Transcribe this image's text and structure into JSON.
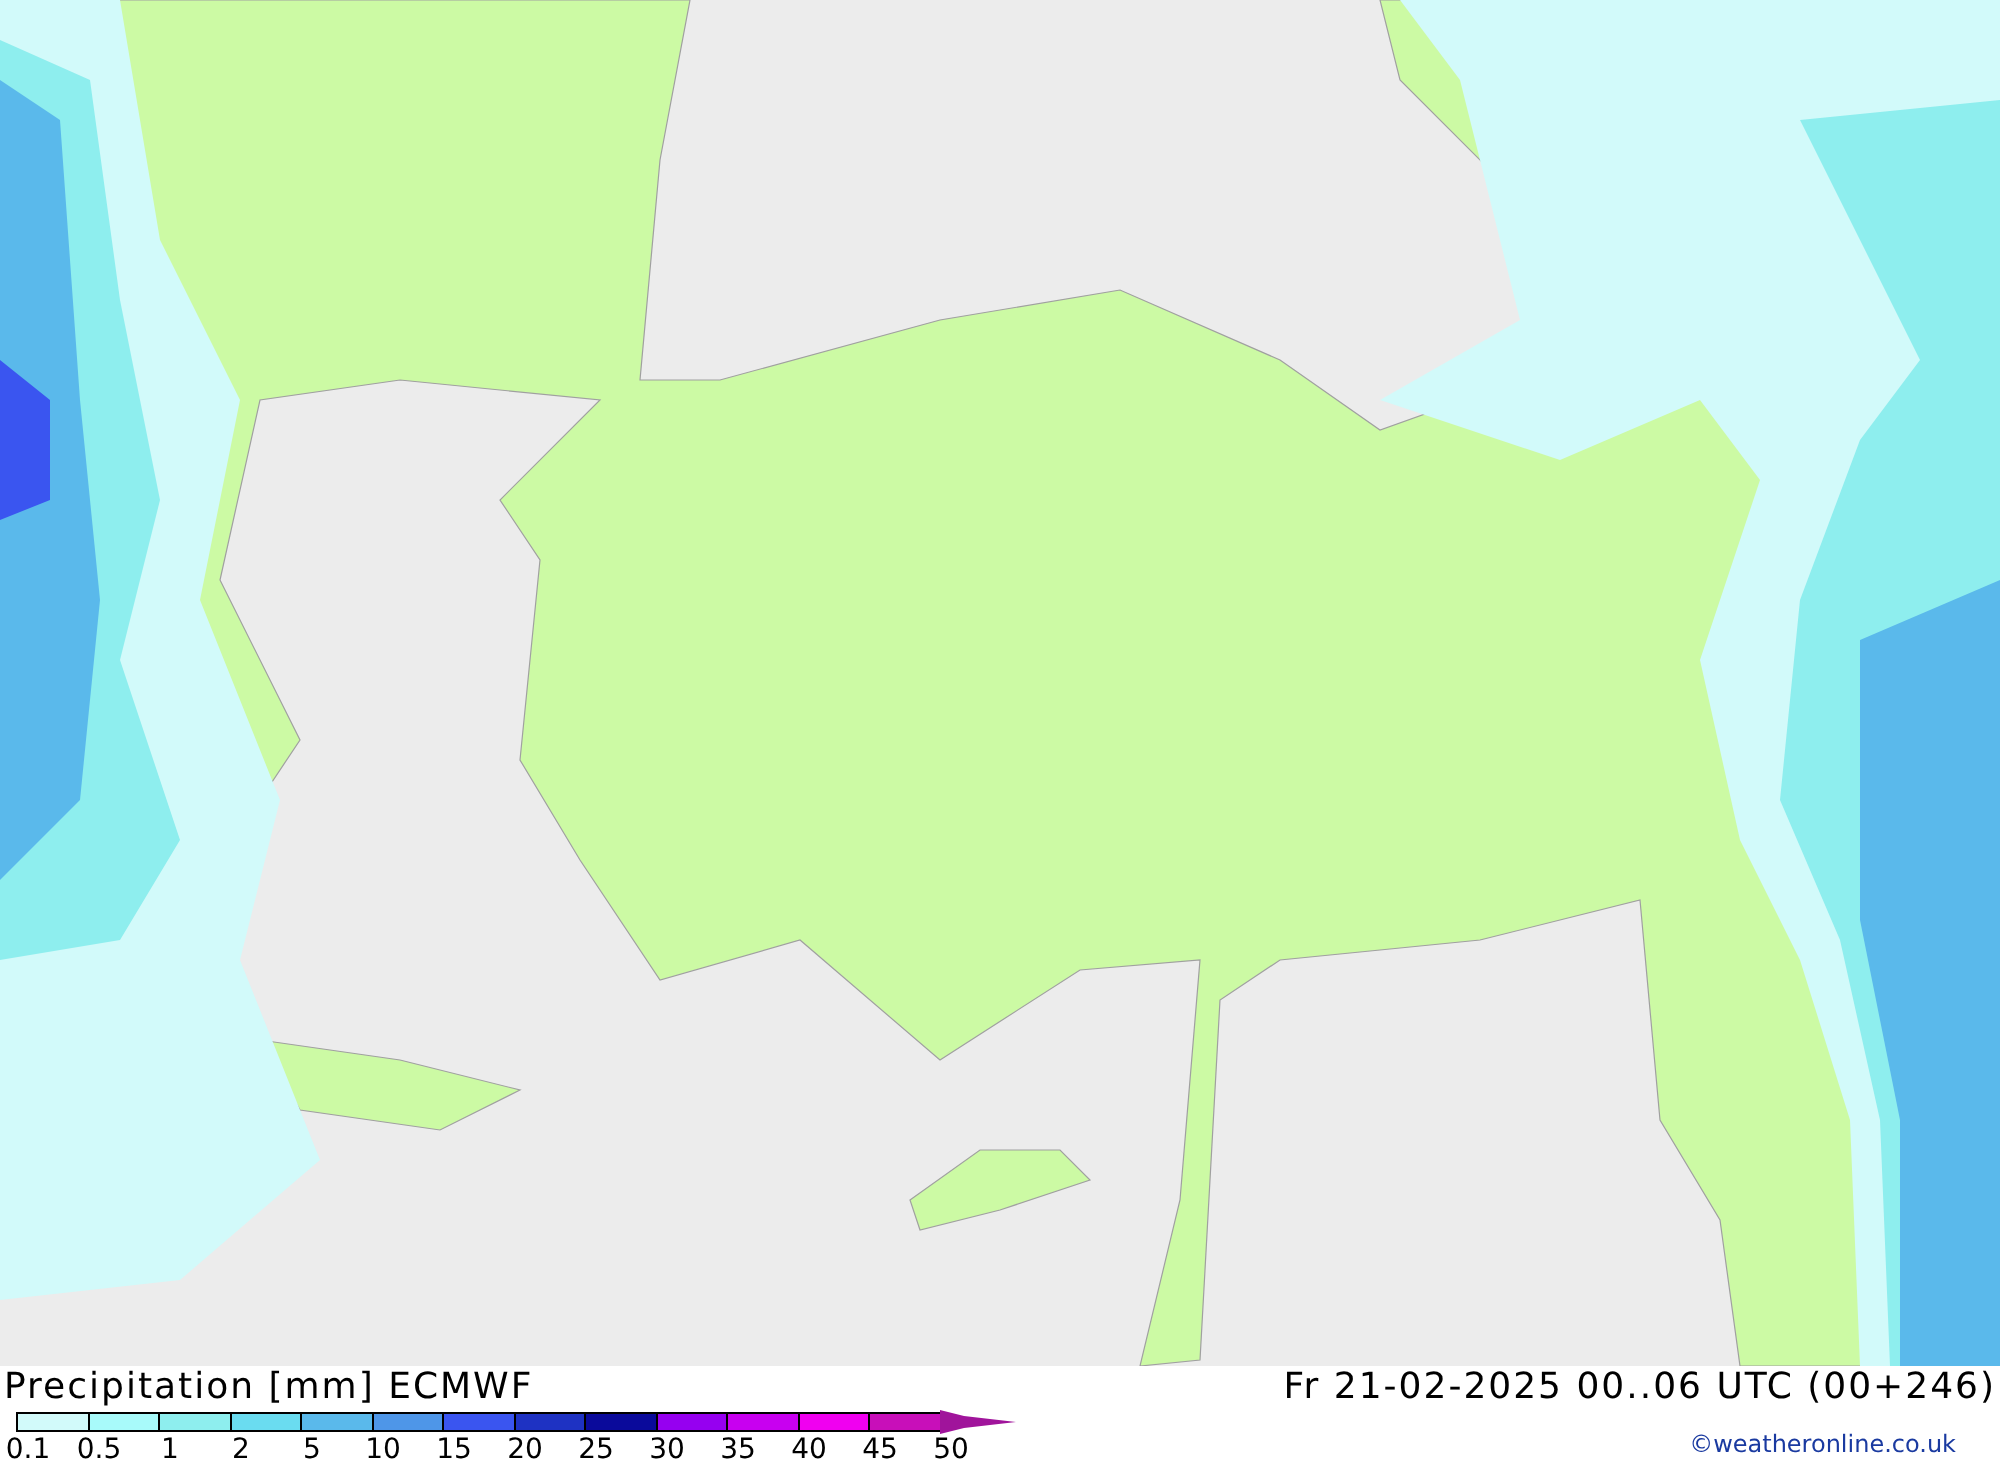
{
  "title": "Precipitation [mm] ECMWF",
  "valid_time": "Fr 21-02-2025 00..06 UTC (00+246)",
  "legend": {
    "bins": [
      {
        "color": "#d2fafa"
      },
      {
        "color": "#a8fafa"
      },
      {
        "color": "#8eeeee"
      },
      {
        "color": "#6adcf0"
      },
      {
        "color": "#5ab9eb"
      },
      {
        "color": "#4e96e8"
      },
      {
        "color": "#3a55f0"
      },
      {
        "color": "#1e32c3"
      },
      {
        "color": "#0a0a9b"
      },
      {
        "color": "#9600f0"
      },
      {
        "color": "#c800f0"
      },
      {
        "color": "#f000f0"
      },
      {
        "color": "#c80fb9"
      },
      {
        "color": "#a0149b",
        "kind": "arrow"
      }
    ],
    "labels": [
      "0.1",
      "0.5",
      "1",
      "2",
      "5",
      "10",
      "15",
      "20",
      "25",
      "30",
      "35",
      "40",
      "45",
      "50"
    ]
  },
  "copyright": "©weatheronline.co.uk"
}
